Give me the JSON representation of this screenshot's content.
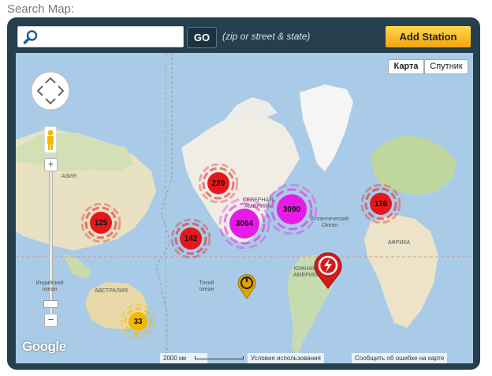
{
  "search": {
    "label": "Search Map:",
    "placeholder": "",
    "go_label": "GO",
    "hint": "(zip or street & state)"
  },
  "add_station": "Add Station",
  "map": {
    "type_buttons": [
      "Карта",
      "Спутник"
    ],
    "active_type": "Карта",
    "zoom_in": "+",
    "zoom_out": "−",
    "clusters": [
      {
        "count": "220",
        "color": "#e8161b"
      },
      {
        "count": "125",
        "color": "#e8161b"
      },
      {
        "count": "142",
        "color": "#e8161b"
      },
      {
        "count": "3064",
        "color": "#e61ce6"
      },
      {
        "count": "3090",
        "color": "#e61ce6"
      },
      {
        "count": "116",
        "color": "#e8161b"
      },
      {
        "count": "33",
        "color": "#f5b800"
      }
    ],
    "labels": {
      "asia": "АЗИЯ",
      "north_america": "СЕВЕРНАЯ АМЕРИКА",
      "atlantic": "Атлантический Океан",
      "africa": "АФРИКА",
      "south_america": "ЮЖНАЯ АМЕРИКА",
      "indian_ocean": "Индийский океан",
      "pacific": "Тихий океан",
      "australia": "АВСТРАЛИЯ"
    },
    "google": "Google",
    "scale": "2000 км",
    "terms": "Условия использования",
    "report": "Сообщить об ошибке на карте"
  }
}
